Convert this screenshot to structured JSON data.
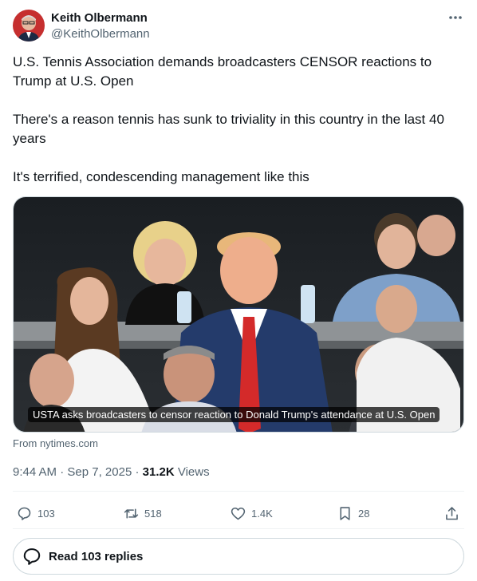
{
  "author": {
    "display_name": "Keith Olbermann",
    "handle": "@KeithOlbermann",
    "avatar_icon": "avatar-photo"
  },
  "more_icon": "more-horizontal-icon",
  "tweet": {
    "paragraphs": [
      "U.S. Tennis Association demands broadcasters CENSOR reactions to Trump at U.S. Open",
      "There's a reason tennis has sunk to triviality in this country in the last 40 years",
      "It's terrified, condescending management like this"
    ]
  },
  "media": {
    "caption": "USTA asks broadcasters to censor reaction to Donald Trump's attendance at U.S. Open",
    "source": "From nytimes.com"
  },
  "meta": {
    "time": "9:44 AM",
    "separator": " · ",
    "date": "Sep 7, 2025",
    "views_count": "31.2K",
    "views_label": " Views"
  },
  "actions": {
    "replies": "103",
    "reposts": "518",
    "likes": "1.4K",
    "bookmarks": "28"
  },
  "read_replies_label": "Read 103 replies",
  "colors": {
    "text_primary": "#0f1419",
    "text_secondary": "#536471",
    "border": "#cfd9de"
  }
}
